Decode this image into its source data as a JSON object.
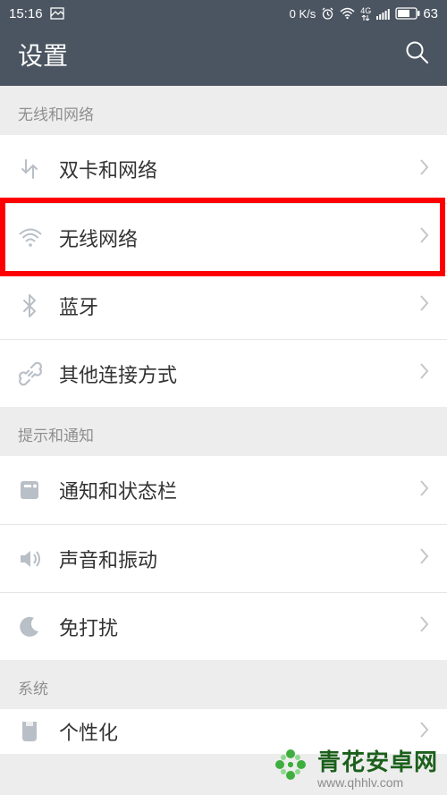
{
  "status": {
    "time": "15:16",
    "net_speed": "0 K/s",
    "battery": "63"
  },
  "header": {
    "title": "设置"
  },
  "sections": [
    {
      "label": "无线和网络",
      "items": [
        {
          "key": "dual-sim",
          "label": "双卡和网络"
        },
        {
          "key": "wifi",
          "label": "无线网络"
        },
        {
          "key": "bt",
          "label": "蓝牙"
        },
        {
          "key": "other",
          "label": "其他连接方式"
        }
      ]
    },
    {
      "label": "提示和通知",
      "items": [
        {
          "key": "notif",
          "label": "通知和状态栏"
        },
        {
          "key": "sound",
          "label": "声音和振动"
        },
        {
          "key": "dnd",
          "label": "免打扰"
        }
      ]
    },
    {
      "label": "系统",
      "items": [
        {
          "key": "personal",
          "label": "个性化"
        }
      ]
    }
  ],
  "highlight_index": {
    "section": 0,
    "item": 1
  },
  "watermark": {
    "brand": "青花安卓网",
    "url": "www.qhhlv.com"
  }
}
